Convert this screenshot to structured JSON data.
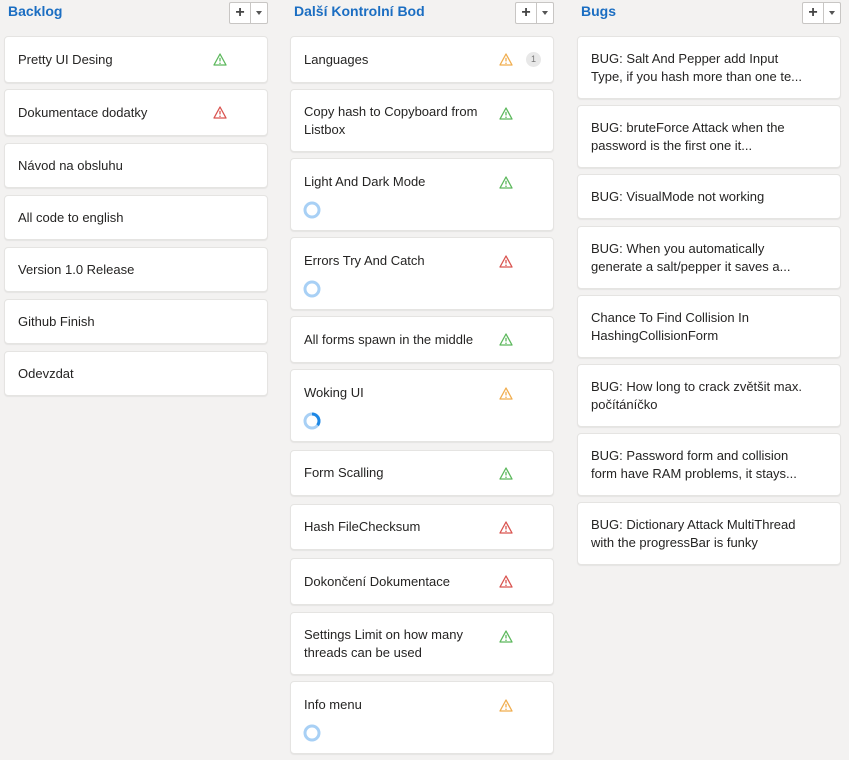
{
  "colors": {
    "accent": "#1b6ec2",
    "ok": "#5cb85c",
    "warning": "#f0ad4e",
    "danger": "#d9534f",
    "progress": "#5fa6ea"
  },
  "columns": [
    {
      "title": "Backlog",
      "cards": [
        {
          "title": "Pretty UI Desing",
          "status": "ok"
        },
        {
          "title": "Dokumentace dodatky",
          "status": "danger"
        },
        {
          "title": "Návod na obsluhu"
        },
        {
          "title": "All code to english"
        },
        {
          "title": "Version 1.0 Release"
        },
        {
          "title": "Github Finish"
        },
        {
          "title": "Odevzdat"
        }
      ]
    },
    {
      "title": "Další Kontrolní Bod",
      "cards": [
        {
          "title": "Languages",
          "status": "warning",
          "badge": "1"
        },
        {
          "title": "Copy hash to Copyboard from Listbox",
          "status": "ok"
        },
        {
          "title": "Light And Dark Mode",
          "status": "ok",
          "progress": 0
        },
        {
          "title": "Errors Try And Catch",
          "status": "danger",
          "progress": 0
        },
        {
          "title": "All forms spawn in the middle",
          "status": "ok"
        },
        {
          "title": "Woking UI",
          "status": "warning",
          "progress": 0.35
        },
        {
          "title": "Form Scalling",
          "status": "ok"
        },
        {
          "title": "Hash FileChecksum",
          "status": "danger"
        },
        {
          "title": "Dokončení Dokumentace",
          "status": "danger"
        },
        {
          "title": "Settings Limit on how many threads can be used",
          "status": "ok"
        },
        {
          "title": "Info menu",
          "status": "warning",
          "progress": 0
        }
      ]
    },
    {
      "title": "Bugs",
      "cards": [
        {
          "title": "BUG: Salt And Pepper add Input Type, if you hash more than one te..."
        },
        {
          "title": "BUG: bruteForce Attack when the password is the first one it..."
        },
        {
          "title": "BUG: VisualMode not working"
        },
        {
          "title": "BUG: When you automatically generate a salt/pepper it saves a..."
        },
        {
          "title": "Chance To Find Collision In HashingCollisionForm"
        },
        {
          "title": "BUG: How long to crack zvětšit max. počítáníčko"
        },
        {
          "title": "BUG: Password form and collision form have RAM problems, it stays..."
        },
        {
          "title": "BUG: Dictionary Attack MultiThread with the progressBar is funky"
        }
      ]
    }
  ]
}
